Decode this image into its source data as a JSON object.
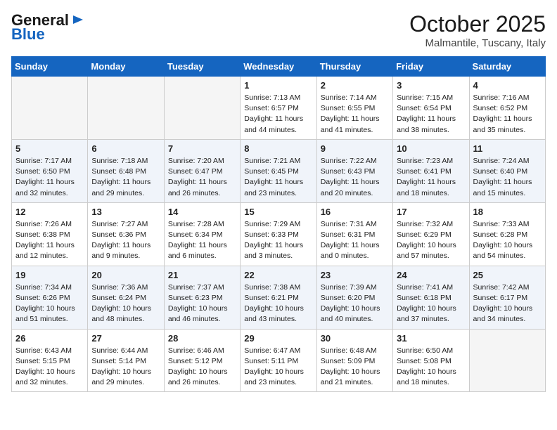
{
  "header": {
    "logo_general": "General",
    "logo_blue": "Blue",
    "month": "October 2025",
    "location": "Malmantile, Tuscany, Italy"
  },
  "weekdays": [
    "Sunday",
    "Monday",
    "Tuesday",
    "Wednesday",
    "Thursday",
    "Friday",
    "Saturday"
  ],
  "weeks": [
    [
      {
        "day": "",
        "info": ""
      },
      {
        "day": "",
        "info": ""
      },
      {
        "day": "",
        "info": ""
      },
      {
        "day": "1",
        "info": "Sunrise: 7:13 AM\nSunset: 6:57 PM\nDaylight: 11 hours and 44 minutes."
      },
      {
        "day": "2",
        "info": "Sunrise: 7:14 AM\nSunset: 6:55 PM\nDaylight: 11 hours and 41 minutes."
      },
      {
        "day": "3",
        "info": "Sunrise: 7:15 AM\nSunset: 6:54 PM\nDaylight: 11 hours and 38 minutes."
      },
      {
        "day": "4",
        "info": "Sunrise: 7:16 AM\nSunset: 6:52 PM\nDaylight: 11 hours and 35 minutes."
      }
    ],
    [
      {
        "day": "5",
        "info": "Sunrise: 7:17 AM\nSunset: 6:50 PM\nDaylight: 11 hours and 32 minutes."
      },
      {
        "day": "6",
        "info": "Sunrise: 7:18 AM\nSunset: 6:48 PM\nDaylight: 11 hours and 29 minutes."
      },
      {
        "day": "7",
        "info": "Sunrise: 7:20 AM\nSunset: 6:47 PM\nDaylight: 11 hours and 26 minutes."
      },
      {
        "day": "8",
        "info": "Sunrise: 7:21 AM\nSunset: 6:45 PM\nDaylight: 11 hours and 23 minutes."
      },
      {
        "day": "9",
        "info": "Sunrise: 7:22 AM\nSunset: 6:43 PM\nDaylight: 11 hours and 20 minutes."
      },
      {
        "day": "10",
        "info": "Sunrise: 7:23 AM\nSunset: 6:41 PM\nDaylight: 11 hours and 18 minutes."
      },
      {
        "day": "11",
        "info": "Sunrise: 7:24 AM\nSunset: 6:40 PM\nDaylight: 11 hours and 15 minutes."
      }
    ],
    [
      {
        "day": "12",
        "info": "Sunrise: 7:26 AM\nSunset: 6:38 PM\nDaylight: 11 hours and 12 minutes."
      },
      {
        "day": "13",
        "info": "Sunrise: 7:27 AM\nSunset: 6:36 PM\nDaylight: 11 hours and 9 minutes."
      },
      {
        "day": "14",
        "info": "Sunrise: 7:28 AM\nSunset: 6:34 PM\nDaylight: 11 hours and 6 minutes."
      },
      {
        "day": "15",
        "info": "Sunrise: 7:29 AM\nSunset: 6:33 PM\nDaylight: 11 hours and 3 minutes."
      },
      {
        "day": "16",
        "info": "Sunrise: 7:31 AM\nSunset: 6:31 PM\nDaylight: 11 hours and 0 minutes."
      },
      {
        "day": "17",
        "info": "Sunrise: 7:32 AM\nSunset: 6:29 PM\nDaylight: 10 hours and 57 minutes."
      },
      {
        "day": "18",
        "info": "Sunrise: 7:33 AM\nSunset: 6:28 PM\nDaylight: 10 hours and 54 minutes."
      }
    ],
    [
      {
        "day": "19",
        "info": "Sunrise: 7:34 AM\nSunset: 6:26 PM\nDaylight: 10 hours and 51 minutes."
      },
      {
        "day": "20",
        "info": "Sunrise: 7:36 AM\nSunset: 6:24 PM\nDaylight: 10 hours and 48 minutes."
      },
      {
        "day": "21",
        "info": "Sunrise: 7:37 AM\nSunset: 6:23 PM\nDaylight: 10 hours and 46 minutes."
      },
      {
        "day": "22",
        "info": "Sunrise: 7:38 AM\nSunset: 6:21 PM\nDaylight: 10 hours and 43 minutes."
      },
      {
        "day": "23",
        "info": "Sunrise: 7:39 AM\nSunset: 6:20 PM\nDaylight: 10 hours and 40 minutes."
      },
      {
        "day": "24",
        "info": "Sunrise: 7:41 AM\nSunset: 6:18 PM\nDaylight: 10 hours and 37 minutes."
      },
      {
        "day": "25",
        "info": "Sunrise: 7:42 AM\nSunset: 6:17 PM\nDaylight: 10 hours and 34 minutes."
      }
    ],
    [
      {
        "day": "26",
        "info": "Sunrise: 6:43 AM\nSunset: 5:15 PM\nDaylight: 10 hours and 32 minutes."
      },
      {
        "day": "27",
        "info": "Sunrise: 6:44 AM\nSunset: 5:14 PM\nDaylight: 10 hours and 29 minutes."
      },
      {
        "day": "28",
        "info": "Sunrise: 6:46 AM\nSunset: 5:12 PM\nDaylight: 10 hours and 26 minutes."
      },
      {
        "day": "29",
        "info": "Sunrise: 6:47 AM\nSunset: 5:11 PM\nDaylight: 10 hours and 23 minutes."
      },
      {
        "day": "30",
        "info": "Sunrise: 6:48 AM\nSunset: 5:09 PM\nDaylight: 10 hours and 21 minutes."
      },
      {
        "day": "31",
        "info": "Sunrise: 6:50 AM\nSunset: 5:08 PM\nDaylight: 10 hours and 18 minutes."
      },
      {
        "day": "",
        "info": ""
      }
    ]
  ]
}
